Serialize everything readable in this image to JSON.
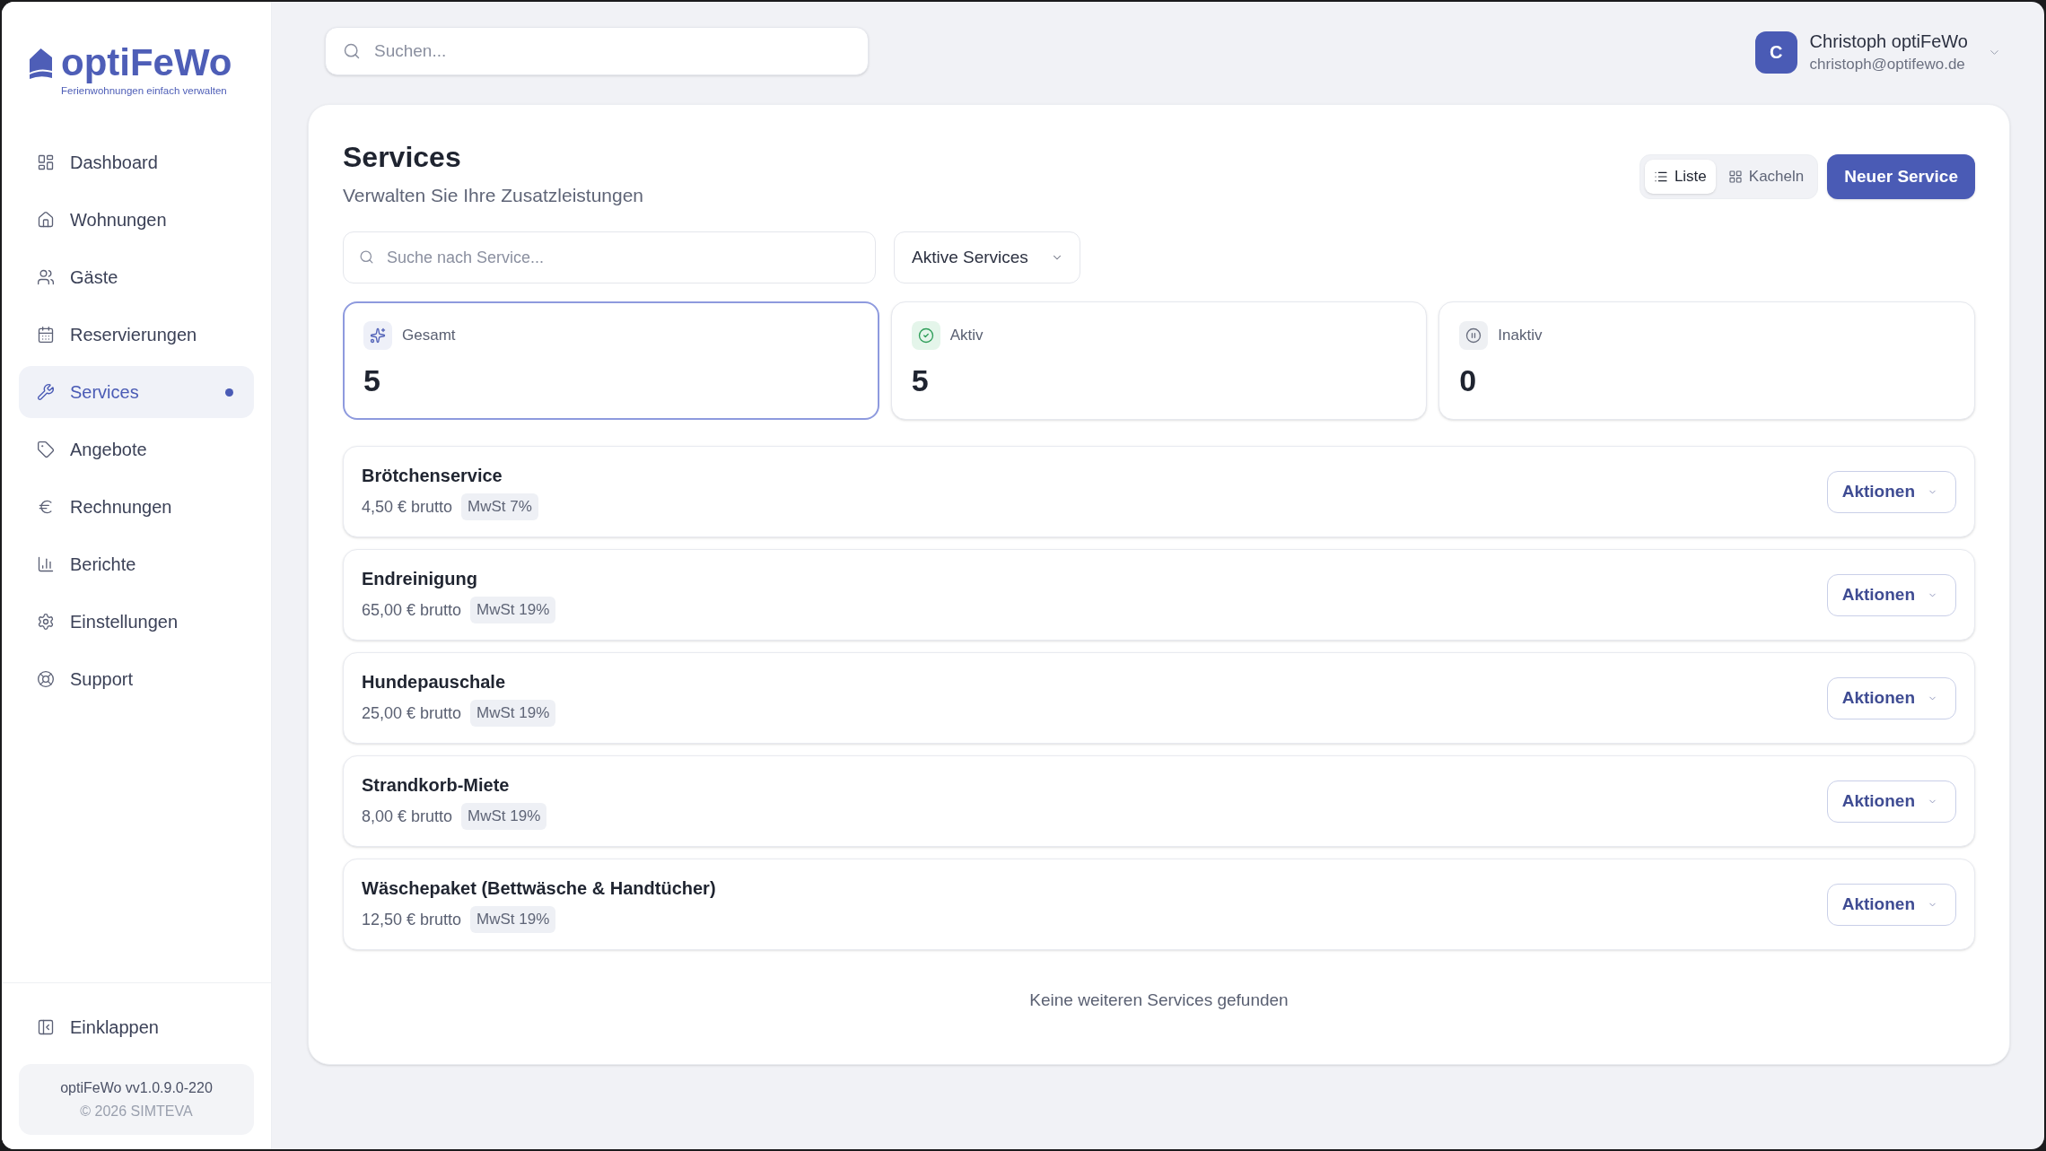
{
  "logo": {
    "name": "optiFeWo",
    "tagline": "Ferienwohnungen einfach verwalten"
  },
  "sidebar": {
    "items": [
      {
        "label": "Dashboard",
        "selected": false
      },
      {
        "label": "Wohnungen",
        "selected": false
      },
      {
        "label": "Gäste",
        "selected": false
      },
      {
        "label": "Reservierungen",
        "selected": false
      },
      {
        "label": "Services",
        "selected": true
      },
      {
        "label": "Angebote",
        "selected": false
      },
      {
        "label": "Rechnungen",
        "selected": false
      },
      {
        "label": "Berichte",
        "selected": false
      },
      {
        "label": "Einstellungen",
        "selected": false
      },
      {
        "label": "Support",
        "selected": false
      }
    ],
    "collapse_label": "Einklappen",
    "version": "optiFeWo vv1.0.9.0-220",
    "copyright": "© 2026 SIMTEVA"
  },
  "header": {
    "search": {
      "placeholder": "Suchen..."
    },
    "user": {
      "initial": "C",
      "name": "Christoph optiFeWo",
      "email": "christoph@optifewo.de"
    }
  },
  "page": {
    "title": "Services",
    "subtitle": "Verwalten Sie Ihre Zusatzleistungen",
    "view_toggle": [
      {
        "label": "Liste",
        "selected": true
      },
      {
        "label": "Kacheln",
        "selected": false
      }
    ],
    "new_button": "Neuer Service",
    "filter": {
      "search": {
        "placeholder": "Suche nach Service..."
      },
      "status_select": "Aktive Services"
    },
    "stats": [
      {
        "label": "Gesamt",
        "value": "5",
        "selected": true
      },
      {
        "label": "Aktiv",
        "value": "5",
        "selected": false
      },
      {
        "label": "Inaktiv",
        "value": "0",
        "selected": false
      }
    ],
    "services": [
      {
        "name": "Brötchenservice",
        "price": "4,50 € brutto",
        "tax": "MwSt 7%",
        "action": "Aktionen"
      },
      {
        "name": "Endreinigung",
        "price": "65,00 € brutto",
        "tax": "MwSt 19%",
        "action": "Aktionen"
      },
      {
        "name": "Hundepauschale",
        "price": "25,00 € brutto",
        "tax": "MwSt 19%",
        "action": "Aktionen"
      },
      {
        "name": "Strandkorb-Miete",
        "price": "8,00 € brutto",
        "tax": "MwSt 19%",
        "action": "Aktionen"
      },
      {
        "name": "Wäschepaket (Bettwäsche & Handtücher)",
        "price": "12,50 € brutto",
        "tax": "MwSt 19%",
        "action": "Aktionen"
      }
    ],
    "empty_note": "Keine weiteren Services gefunden"
  }
}
